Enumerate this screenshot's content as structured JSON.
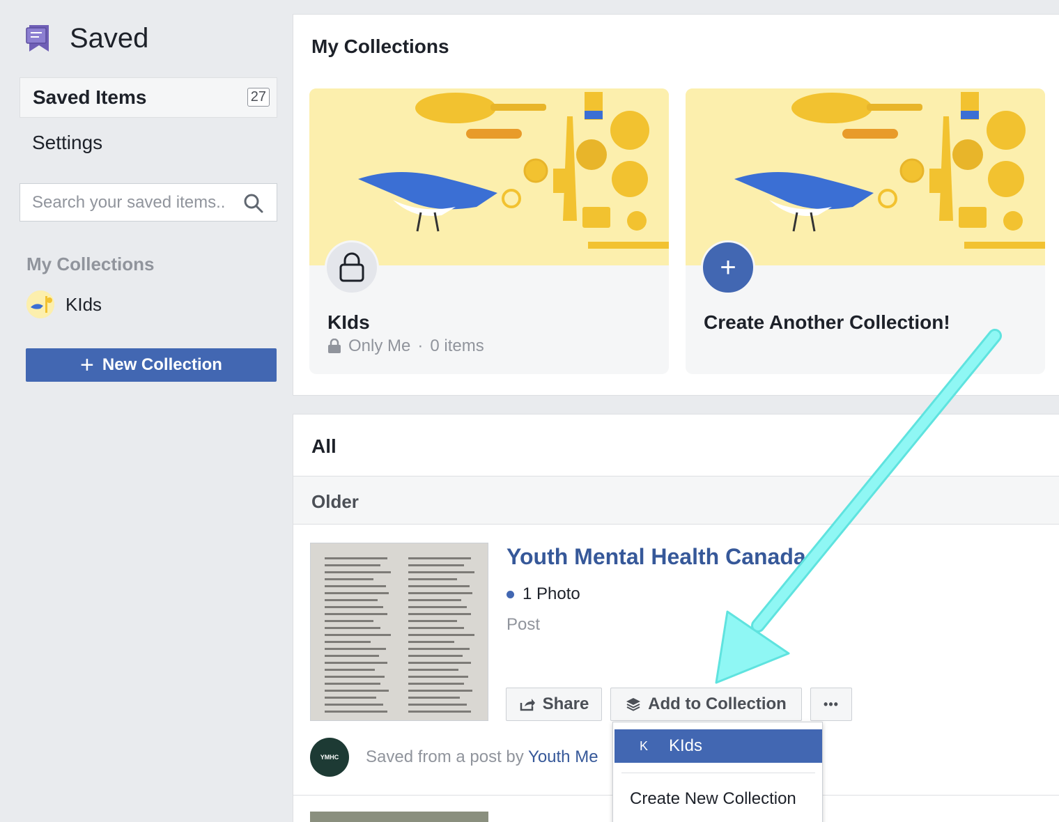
{
  "sidebar": {
    "title": "Saved",
    "nav": [
      {
        "label": "Saved Items",
        "count": "27"
      },
      {
        "label": "Settings"
      }
    ],
    "search_placeholder": "Search your saved items..",
    "collections_heading": "My Collections",
    "collections": [
      {
        "name": "KIds"
      }
    ],
    "new_collection_label": "New Collection"
  },
  "collections_section": {
    "title": "My Collections",
    "tiles": [
      {
        "name": "KIds",
        "privacy": "Only Me",
        "separator": "·",
        "items": "0 items"
      },
      {
        "name": "Create Another Collection!"
      }
    ]
  },
  "all_section": {
    "title": "All",
    "group_label": "Older",
    "post": {
      "title": "Youth Mental Health Canada",
      "photo_count": "1 Photo",
      "type": "Post",
      "share_label": "Share",
      "add_label": "Add to Collection",
      "more_label": "•••",
      "saved_from_prefix": "Saved from a post by",
      "saved_from_author": "Youth Me",
      "avatar_text": "YMHC"
    }
  },
  "dropdown": {
    "items": [
      {
        "initial": "K",
        "label": "KIds"
      }
    ],
    "create_label": "Create New Collection"
  },
  "colors": {
    "accent": "#4267b2",
    "link": "#365899",
    "annotation_arrow": "#8ff7f4",
    "banner": "#fcefad"
  }
}
